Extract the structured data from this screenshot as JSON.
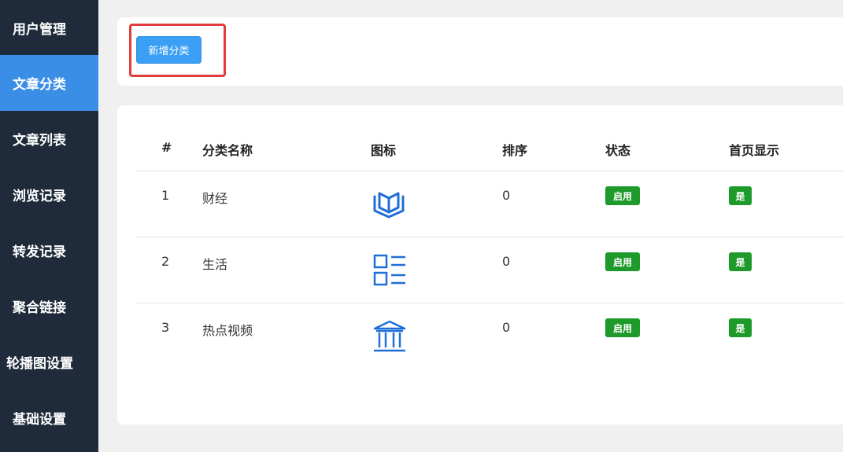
{
  "sidebar": {
    "items": [
      {
        "label": "用户管理",
        "active": false
      },
      {
        "label": "文章分类",
        "active": true
      },
      {
        "label": "文章列表",
        "active": false
      },
      {
        "label": "浏览记录",
        "active": false
      },
      {
        "label": "转发记录",
        "active": false
      },
      {
        "label": "聚合链接",
        "active": false
      },
      {
        "label": "轮播图设置",
        "active": false
      },
      {
        "label": "基础设置",
        "active": false
      }
    ]
  },
  "toolbar": {
    "add_label": "新增分类"
  },
  "table": {
    "headers": {
      "index": "#",
      "name": "分类名称",
      "icon": "图标",
      "sort": "排序",
      "status": "状态",
      "home": "首页显示"
    },
    "rows": [
      {
        "index": "1",
        "name": "财经",
        "icon": "book-icon",
        "sort": "0",
        "status": "启用",
        "home": "是"
      },
      {
        "index": "2",
        "name": "生活",
        "icon": "list-icon",
        "sort": "0",
        "status": "启用",
        "home": "是"
      },
      {
        "index": "3",
        "name": "热点视频",
        "icon": "bank-icon",
        "sort": "0",
        "status": "启用",
        "home": "是"
      }
    ]
  },
  "colors": {
    "sidebar_bg": "#1f2b3a",
    "active_bg": "#3a8ee6",
    "button_bg": "#3a9ff5",
    "badge_green": "#1e9a2a",
    "icon_blue": "#1f6fd8",
    "highlight_red": "#e23b3b"
  }
}
